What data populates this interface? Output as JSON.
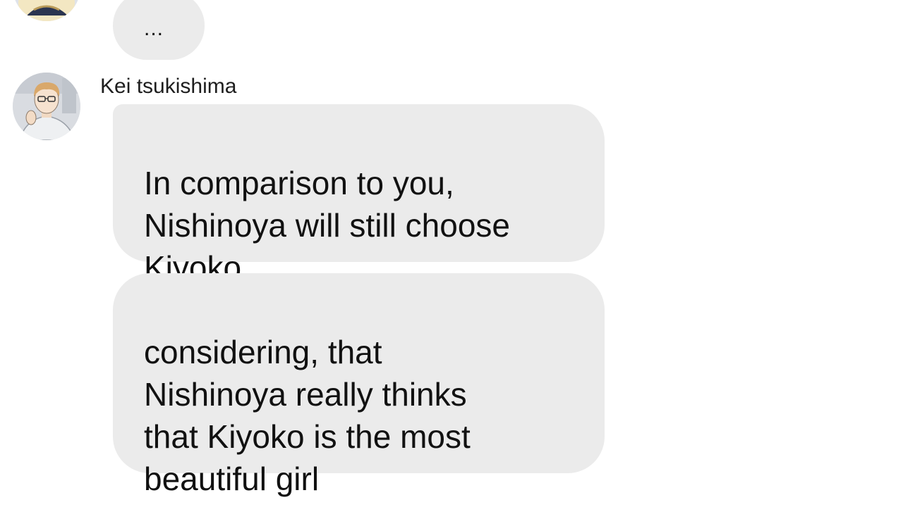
{
  "conversation": {
    "previous_message": {
      "text": "..."
    },
    "sender": {
      "name": "Kei tsukishima",
      "avatar_icon": "profile-avatar-icon"
    },
    "messages": [
      {
        "text": "In comparison to you,\nNishinoya will still choose\nKiyoko"
      },
      {
        "text": "considering, that\nNishinoya really thinks\nthat Kiyoko is the most\nbeautiful girl"
      }
    ]
  },
  "colors": {
    "background": "#ffffff",
    "bubble": "#ebebeb",
    "text": "#111111"
  }
}
